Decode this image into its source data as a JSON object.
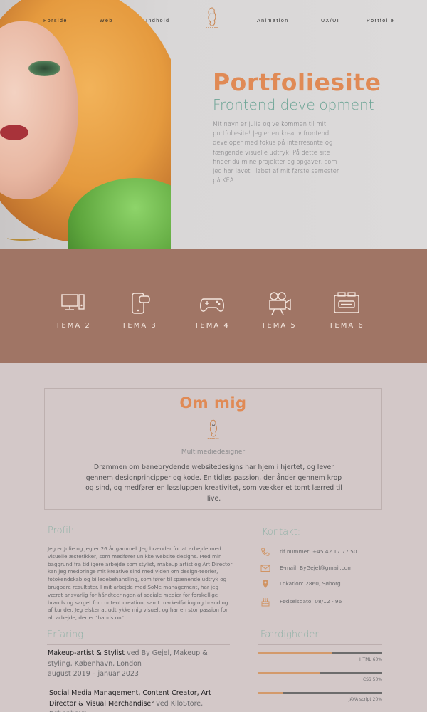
{
  "nav": {
    "items": [
      "Forside",
      "Web",
      "Indhold",
      "Animation",
      "UX/UI",
      "Portfolie"
    ],
    "logo_icon": "julie-gejel-logo-icon"
  },
  "hero": {
    "title": "Portfoliesite",
    "subtitle": "Frontend development",
    "intro": "Mit navn er Julie og velkommen til mit portfoliesite! Jeg er en kreativ frontend developer med fokus på interresante og fængende visuelle udtryk. På dette site finder du mine projekter og opgaver, som jeg har lavet i løbet af mit første semester på KEA"
  },
  "themes": [
    {
      "label": "TEMA 2",
      "icon": "computer-icon"
    },
    {
      "label": "TEMA 3",
      "icon": "phone-chat-icon"
    },
    {
      "label": "TEMA 4",
      "icon": "gamepad-icon"
    },
    {
      "label": "TEMA 5",
      "icon": "film-camera-icon"
    },
    {
      "label": "TEMA 6",
      "icon": "cassette-icon"
    }
  ],
  "about": {
    "title": "Om mig",
    "role": "Multimediedesigner",
    "text": "Drømmen om banebrydende websitedesigns har hjem i hjertet, og lever gennem designprincipper og kode. En tidløs passion, der ånder gennem krop og sind, og medfører en løssluppen kreativitet, som vækker et tomt lærred til live."
  },
  "profile": {
    "heading": "Profil:",
    "text": "Jeg er Julie og jeg er 26 år gammel. Jeg brænder for at arbejde med visuelle æstetikker, som medfører unikke website designs. Med min baggrund fra tidligere arbejde som stylist, makeup artist og Art Director kan jeg medbringe mit kreative sind med viden om design-teorier, fotokendskab og billedebehandling, som fører til spænende udtryk og brugbare resultater. I mit arbejde med SoMe management, har jeg været ansvarlig for håndteeringen af sociale medier for forskellige brands og sørget for content creation, samt markedføring og branding af kunder. Jeg elsker at udtrykke mig visuelt og har en stor passion for alt arbejde, der er \"hands on\""
  },
  "contact": {
    "heading": "Kontakt:",
    "items": [
      {
        "icon": "phone-icon",
        "text": "tlf nummer: +45 42 17 77 50"
      },
      {
        "icon": "mail-icon",
        "text": "E-mail: ByGejel@gmail.com"
      },
      {
        "icon": "location-pin-icon",
        "text": "Lokation: 2860, Søborg"
      },
      {
        "icon": "birthday-cake-icon",
        "text": "Fødselsdato: 08/12 - 96"
      }
    ]
  },
  "experience": {
    "heading": "Erfaring:",
    "items": [
      {
        "role": "Makeup-artist & Stylist",
        "place": " ved By Gejel, Makeup & styling, København, London",
        "period": "august 2019 – januar 2023"
      },
      {
        "role": "Social Media Management, Content Creator, Art Director & Visual Merchandiser",
        "place": " ved KiloStore, København",
        "period": ""
      }
    ]
  },
  "skills": {
    "heading": "Færdigheder:",
    "items": [
      {
        "label": "HTML 60%",
        "percent": 60
      },
      {
        "label": "CSS 50%",
        "percent": 50
      },
      {
        "label": "JAVA script 20%",
        "percent": 20
      }
    ]
  },
  "colors": {
    "accent_orange": "#e08a55",
    "accent_green": "#6ea596",
    "band_brown": "#a07565",
    "page_bg": "#d3c8c8"
  }
}
